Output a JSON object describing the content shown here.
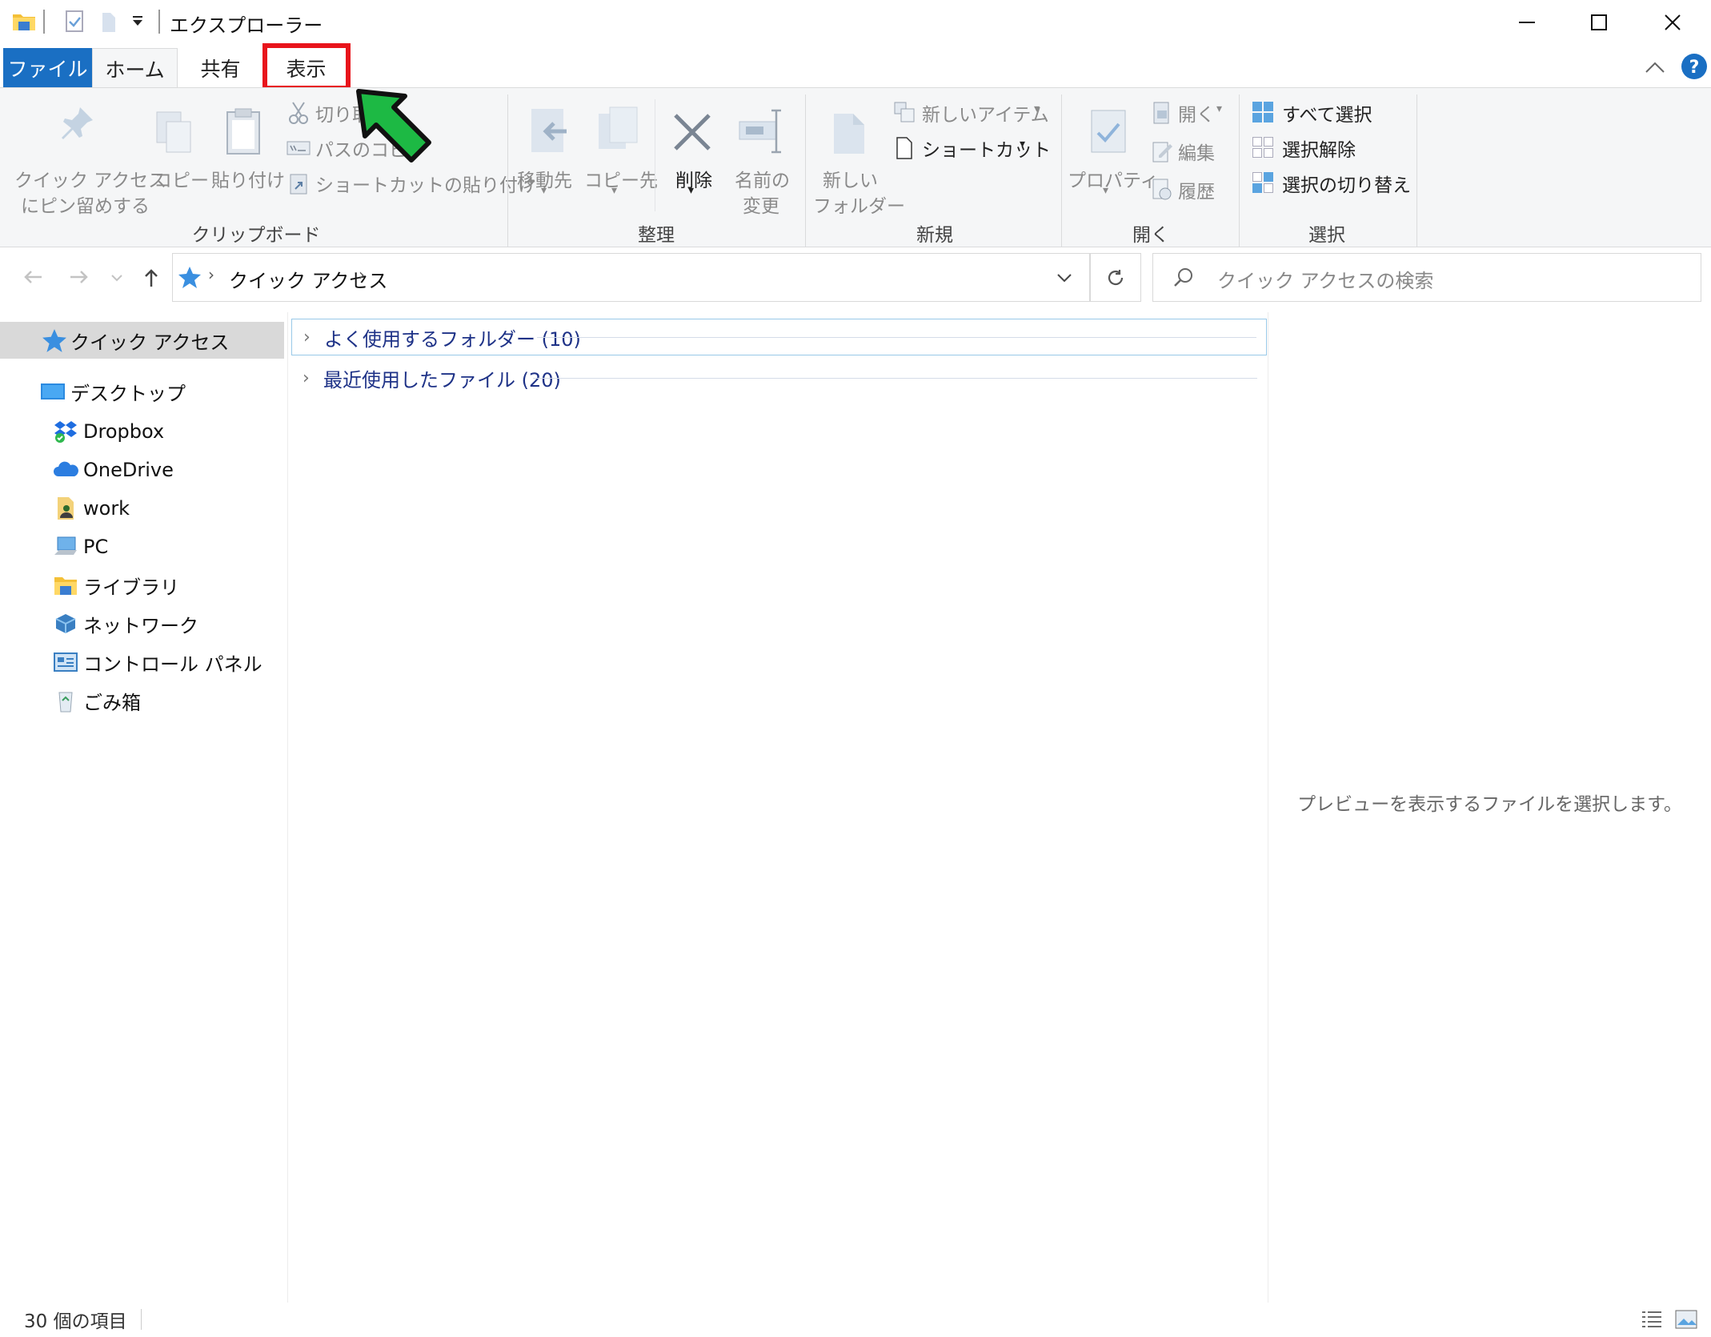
{
  "window": {
    "title": "エクスプローラー"
  },
  "tabs": {
    "file": "ファイル",
    "home": "ホーム",
    "share": "共有",
    "view": "表示"
  },
  "ribbon": {
    "clipboard": {
      "pin_line1": "クイック アクセス",
      "pin_line2": "にピン留めする",
      "copy": "コピー",
      "paste": "貼り付け",
      "cut": "切り取",
      "copy_path": "パスのコピー",
      "paste_shortcut": "ショートカットの貼り付け",
      "group": "クリップボード"
    },
    "organize": {
      "move_to": "移動先",
      "copy_to": "コピー先",
      "delete": "削除",
      "rename_line1": "名前の",
      "rename_line2": "変更",
      "group": "整理"
    },
    "new": {
      "new_folder_line1": "新しい",
      "new_folder_line2": "フォルダー",
      "new_item": "新しいアイテム",
      "shortcut": "ショートカット",
      "group": "新規"
    },
    "open": {
      "properties": "プロパティ",
      "open": "開く",
      "edit": "編集",
      "history": "履歴",
      "group": "開く"
    },
    "select": {
      "select_all": "すべて選択",
      "select_none": "選択解除",
      "invert": "選択の切り替え",
      "group": "選択"
    }
  },
  "address": {
    "path": "クイック アクセス",
    "search_placeholder": "クイック アクセスの検索"
  },
  "nav": {
    "items": [
      {
        "label": "クイック アクセス"
      },
      {
        "label": "デスクトップ"
      },
      {
        "label": "Dropbox"
      },
      {
        "label": "OneDrive"
      },
      {
        "label": "work"
      },
      {
        "label": "PC"
      },
      {
        "label": "ライブラリ"
      },
      {
        "label": "ネットワーク"
      },
      {
        "label": "コントロール パネル"
      },
      {
        "label": "ごみ箱"
      }
    ]
  },
  "content": {
    "groups": [
      {
        "label": "よく使用するフォルダー (10)"
      },
      {
        "label": "最近使用したファイル (20)"
      }
    ]
  },
  "preview": {
    "message": "プレビューを表示するファイルを選択します。"
  },
  "status": {
    "count": "30 個の項目"
  },
  "colors": {
    "file_tab": "#1a6fc3",
    "highlight": "#e8141b",
    "arrow": "#1db944",
    "selected_nav": "#d9d9d9",
    "group_text": "#1e3287"
  }
}
